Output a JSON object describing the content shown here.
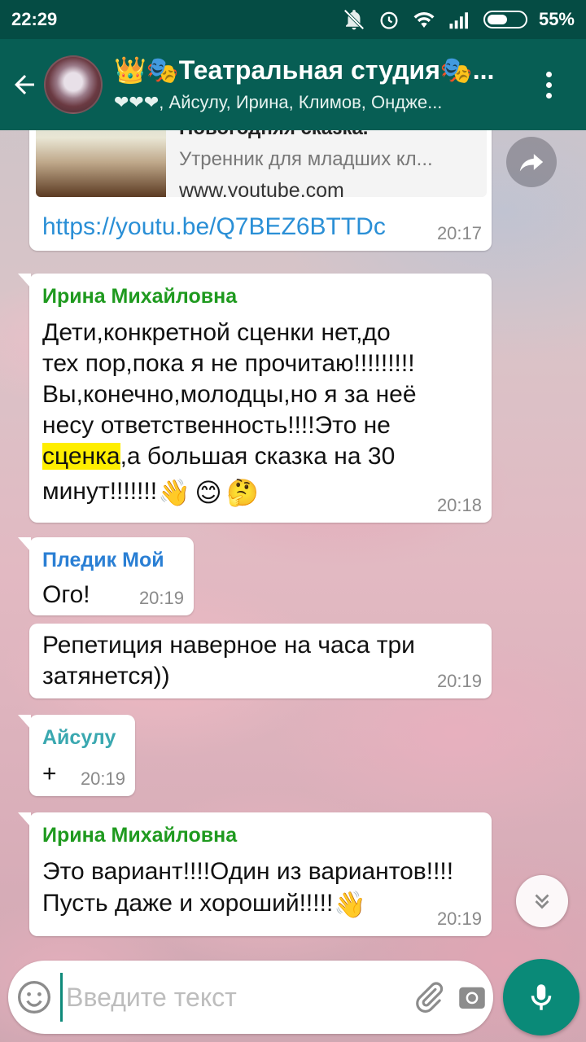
{
  "status_bar": {
    "time": "22:29",
    "battery": "55%"
  },
  "header": {
    "title": "👑🎭Театральная студия🎭...",
    "subtitle": "❤❤❤, Айсулу, Ирина, Климов, Ондже..."
  },
  "messages": [
    {
      "type": "link",
      "preview_title": "Новогодняя сказка.",
      "preview_desc": "Утренник для младших кл...",
      "preview_domain": "www.youtube.com",
      "link": "https://youtu.be/Q7BEZ6BTTDc",
      "time": "20:17"
    },
    {
      "sender": "Ирина Михайловна",
      "sender_color": "#1f9a1f",
      "text_line1": "Дети,конкретной сценки нет,до",
      "text_line2": "тех пор,пока я не прочитаю!!!!!!!!!",
      "text_line3": "Вы,конечно,молодцы,но я за неё",
      "text_line4": "несу ответственность!!!!Это не",
      "highlight": "сценка",
      "text_line5_rest": ",а большая сказка на 30",
      "text_line6": "минут!!!!!!!",
      "emojis": [
        "👋",
        "😊",
        "🤔"
      ],
      "time": "20:18"
    },
    {
      "sender": "Пледик Мой",
      "sender_color": "#2a7fd4",
      "text": "Ого!",
      "time": "20:19"
    },
    {
      "text_line1": "Репетиция наверное на часа три",
      "text_line2": "затянется))",
      "time": "20:19"
    },
    {
      "sender": "Айсулу",
      "sender_color": "#3aa8b0",
      "text": "+",
      "time": "20:19"
    },
    {
      "sender": "Ирина Михайловна",
      "sender_color": "#1f9a1f",
      "text_line1": "Это вариант!!!!Один из вариантов!!!!",
      "text_line2": "Пусть даже и хороший!!!!!",
      "emoji": "👋",
      "time": "20:19"
    }
  ],
  "input": {
    "placeholder": "Введите текст"
  },
  "colors": {
    "header": "#075e54",
    "status_bar": "#054c44",
    "accent": "#0a8a78",
    "link": "#2a8fd6"
  }
}
